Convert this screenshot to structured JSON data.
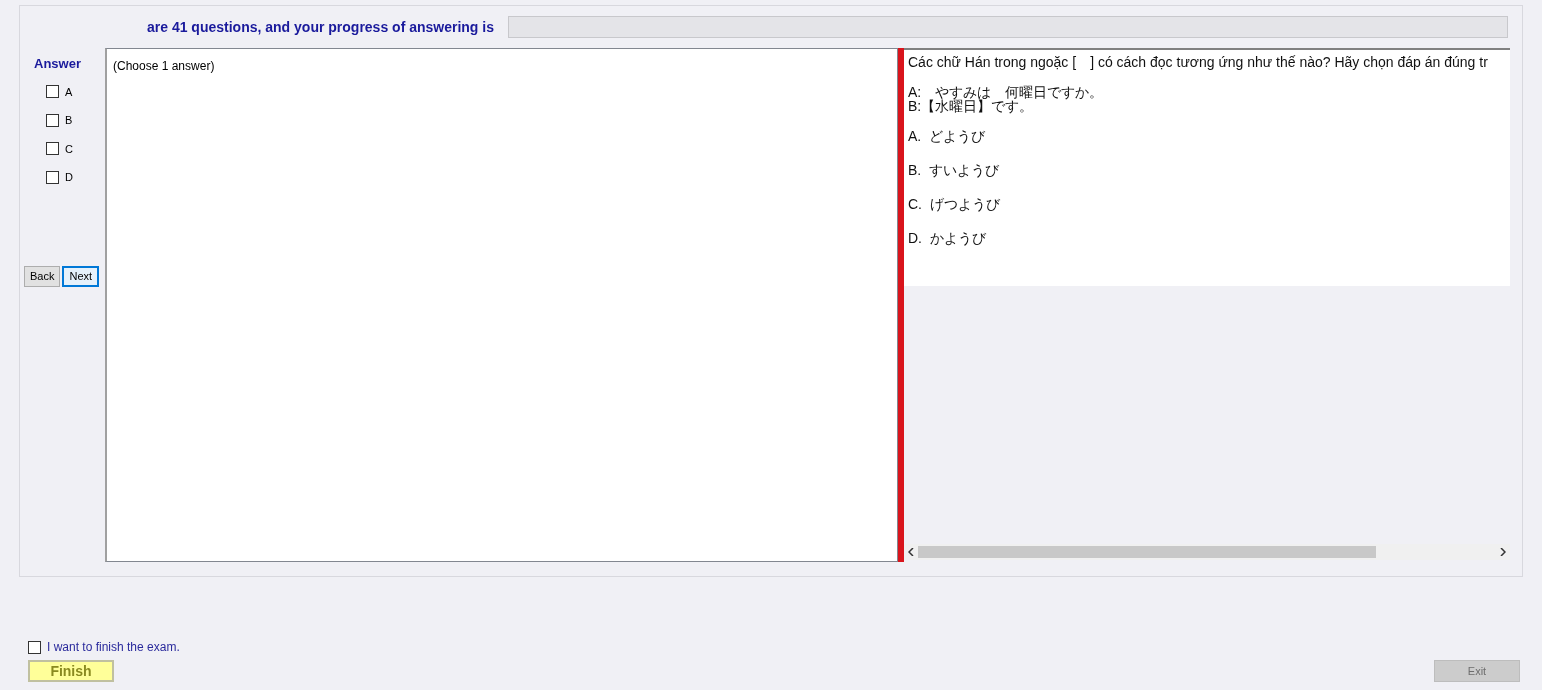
{
  "header": {
    "progress_text": "are 41 questions, and your progress of answering is",
    "progress": {
      "level": 0
    }
  },
  "answer_panel": {
    "title": "Answer",
    "options": [
      {
        "label": "A",
        "checked": false
      },
      {
        "label": "B",
        "checked": false
      },
      {
        "label": "C",
        "checked": false
      },
      {
        "label": "D",
        "checked": false
      }
    ]
  },
  "navigation": [
    {
      "label": "Back",
      "focused": false
    },
    {
      "label": "Next",
      "focused": true
    }
  ],
  "answer_area": {
    "hint": "(Choose 1 answer)"
  },
  "question": {
    "prompt": "Các chữ Hán trong ngoặc [　] có cách đọc tương ứng như thế nào? Hãy chọn đáp án đúng tr",
    "dialogue": [
      "A:　やすみは　何曜日ですか。",
      "B:【水曜日】です。"
    ],
    "choices": [
      "A.  どようび",
      "B.  すいようび",
      "C.  げつようび",
      "D.  かようび"
    ]
  },
  "footer": {
    "confirm": {
      "label": "I want to finish the exam.",
      "checked": false
    },
    "finish_button": {
      "label": "Finish"
    },
    "exit_button": {
      "label": "Exit",
      "disabled": true
    }
  }
}
